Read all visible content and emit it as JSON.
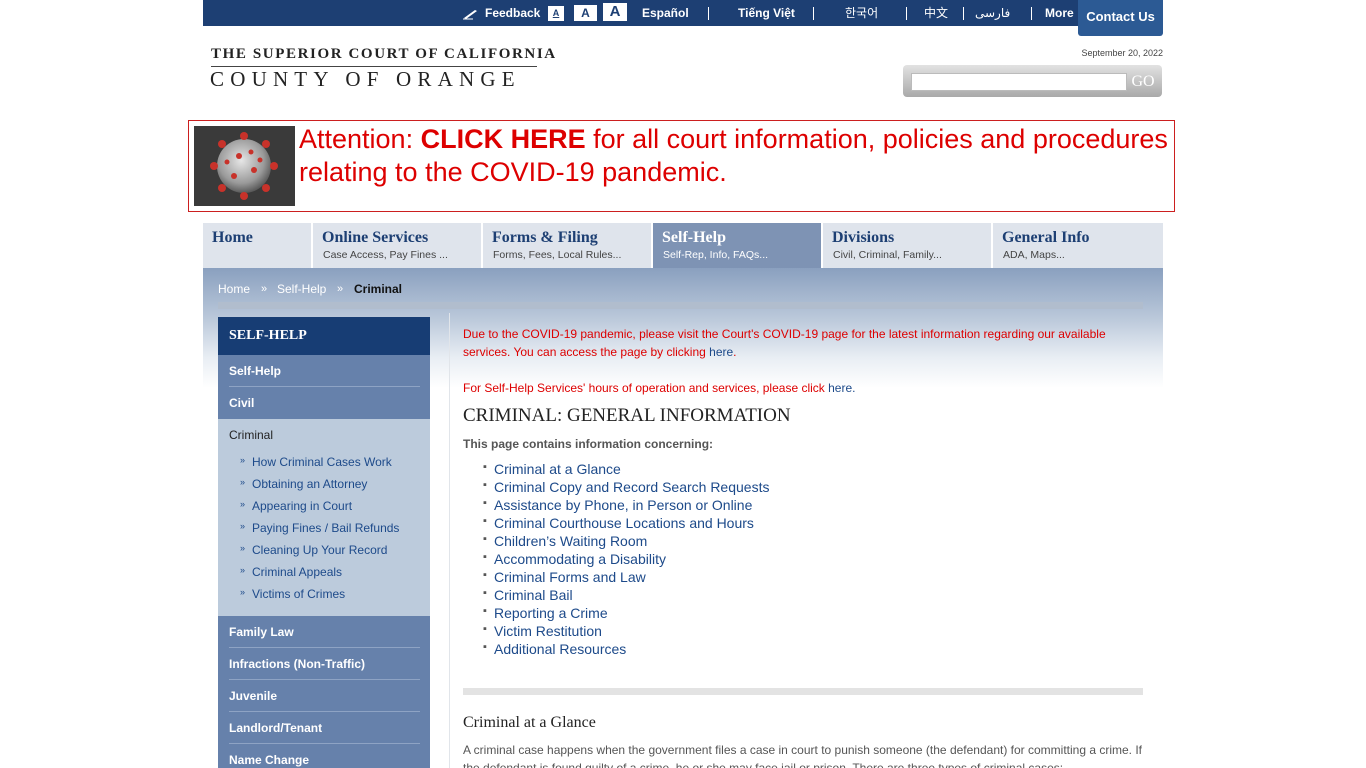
{
  "topbar": {
    "feedback": "Feedback",
    "font_small": "A",
    "font_medium": "A",
    "font_large": "A",
    "languages": [
      "Español",
      "Tiếng Việt",
      "한국어",
      "中文",
      "فارسی"
    ],
    "more": "More",
    "contact": "Contact Us"
  },
  "logo": {
    "line1": "THE SUPERIOR COURT OF CALIFORNIA",
    "line2": "COUNTY OF ORANGE"
  },
  "date": "September 20, 2022",
  "search": {
    "placeholder": "",
    "go": "GO"
  },
  "banner": {
    "prefix": "Attention: ",
    "link": "CLICK HERE",
    "suffix": " for all court information, policies and procedures relating to the COVID-19 pandemic."
  },
  "nav": [
    {
      "title": "Home",
      "sub": ""
    },
    {
      "title": "Online Services",
      "sub": "Case Access, Pay Fines ..."
    },
    {
      "title": "Forms & Filing",
      "sub": "Forms, Fees, Local Rules..."
    },
    {
      "title": "Self-Help",
      "sub": "Self-Rep, Info, FAQs..."
    },
    {
      "title": "Divisions",
      "sub": "Civil, Criminal, Family..."
    },
    {
      "title": "General Info",
      "sub": "ADA, Maps..."
    }
  ],
  "breadcrumb": {
    "home": "Home",
    "sep": "»",
    "self_help": "Self-Help",
    "current": "Criminal"
  },
  "sidebar": {
    "heading": "SELF-HELP",
    "top_items": [
      "Self-Help",
      "Civil"
    ],
    "open_item": "Criminal",
    "sub_items": [
      "How Criminal Cases Work",
      "Obtaining an Attorney",
      "Appearing in Court",
      "Paying Fines / Bail Refunds",
      "Cleaning Up Your Record",
      "Criminal Appeals",
      "Victims of Crimes"
    ],
    "bottom_items": [
      "Family Law",
      "Infractions (Non-Traffic)",
      "Juvenile",
      "Landlord/Tenant",
      "Name Change"
    ]
  },
  "main": {
    "notice1": "Due to the COVID-19 pandemic, please visit the Court's COVID-19 page for the latest information regarding our available services. You can access the page by clicking ",
    "notice1_link": "here",
    "notice2": "For Self-Help Services' hours of operation and services, please click ",
    "notice2_link": "here",
    "heading": "CRIMINAL: GENERAL INFORMATION",
    "intro": "This page contains information concerning:",
    "toc": [
      "Criminal at a Glance",
      "Criminal Copy and Record Search Requests",
      "Assistance by Phone, in Person or Online",
      "Criminal Courthouse Locations and Hours",
      "Children’s Waiting Room",
      "Accommodating a Disability",
      "Criminal Forms and Law",
      "Criminal Bail",
      "Reporting a Crime",
      "Victim Restitution",
      "Additional Resources"
    ],
    "section_title": "Criminal at a Glance",
    "section_text": "A criminal case happens when the government files a case in court to punish someone (the defendant) for committing a crime. If the defendant is found guilty of a crime, he or she may face jail or prison. There are three types of criminal cases:"
  },
  "colors": {
    "topbar": "#1d3f73",
    "alert_red": "#dd0000",
    "link_blue": "#1d4a8a",
    "sidebar_dark": "#173d74",
    "sidebar_mid": "#6681ab",
    "active_tab": "#7e93b4"
  },
  "icons": {
    "feedback": "pen-icon",
    "banner_image": "coronavirus-image",
    "submenu_bullet": "double-chevron-right-icon"
  }
}
